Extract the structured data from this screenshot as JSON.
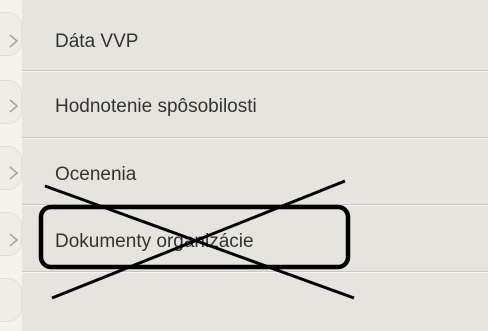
{
  "menu": {
    "items": [
      {
        "label": "Dáta VVP",
        "icon": "chevron-right-icon"
      },
      {
        "label": "Hodnotenie spôsobilosti",
        "icon": "chevron-right-icon"
      },
      {
        "label": "Ocenenia",
        "icon": "chevron-right-icon"
      },
      {
        "label": "Dokumenty organizácie",
        "icon": "chevron-right-icon"
      }
    ]
  },
  "annotation": {
    "highlight_box_color": "#000000",
    "cross_out_color": "#000000",
    "target_item": "Dokumenty organizácie"
  }
}
